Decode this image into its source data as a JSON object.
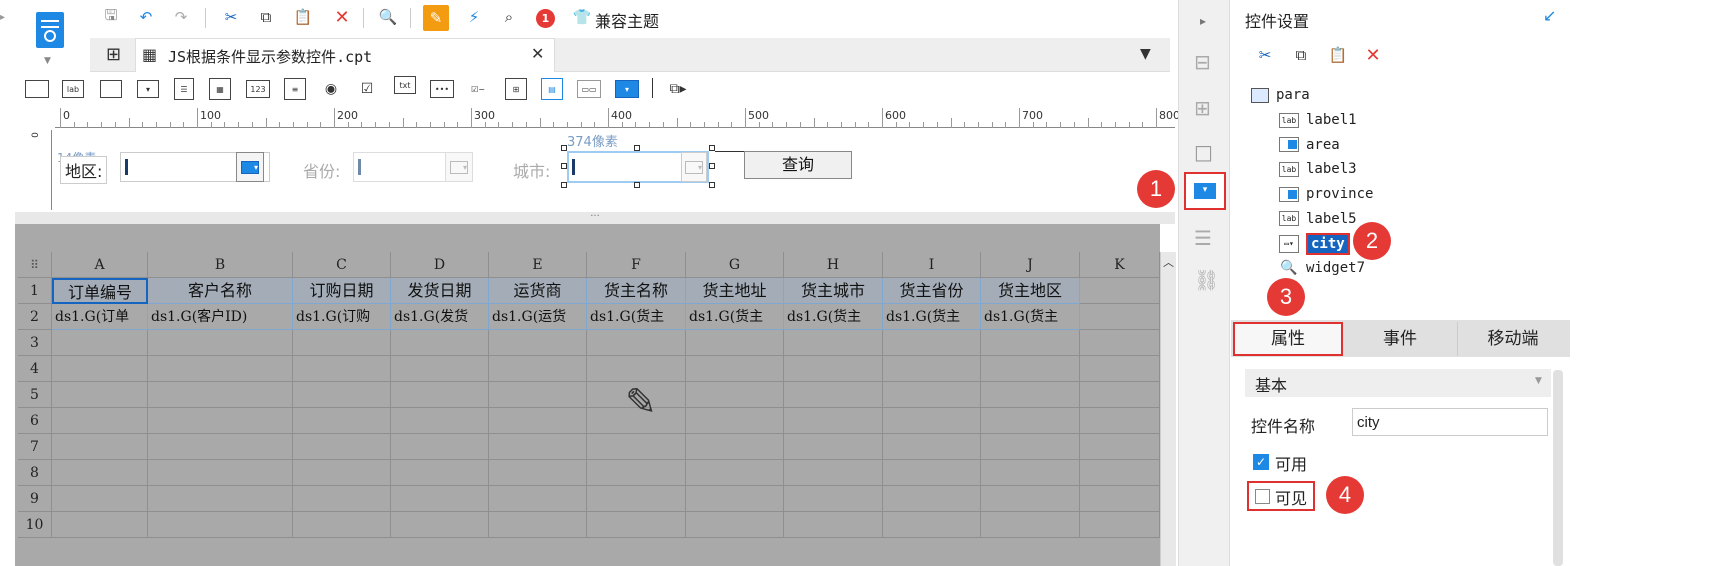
{
  "toolbar": {
    "notify_count": "1",
    "theme_label": "兼容主题"
  },
  "tab": {
    "file_name": "JS根据条件显示参数控件.cpt"
  },
  "widget_palette": [
    "lab",
    "123",
    "txt"
  ],
  "ruler": {
    "ticks": [
      "0",
      "100",
      "200",
      "300",
      "400",
      "500",
      "600",
      "700",
      "800"
    ]
  },
  "param_panel": {
    "size_hint_left": "14像素",
    "size_hint_top": "374像素",
    "area_label": "地区:",
    "province_label": "省份:",
    "city_label": "城市:",
    "query_button": "查询",
    "splitter": "···"
  },
  "sheet": {
    "columns": [
      "A",
      "B",
      "C",
      "D",
      "E",
      "F",
      "G",
      "H",
      "I",
      "J",
      "K"
    ],
    "rows": [
      "1",
      "2",
      "3",
      "4",
      "5",
      "6",
      "7",
      "8",
      "9",
      "10"
    ],
    "header_row": [
      "订单编号",
      "客户名称",
      "订购日期",
      "发货日期",
      "运货商",
      "货主名称",
      "货主地址",
      "货主城市",
      "货主省份",
      "货主地区"
    ],
    "data_row": [
      "ds1.G(订单",
      "ds1.G(客户ID)",
      "ds1.G(订购",
      "ds1.G(发货",
      "ds1.G(运货",
      "ds1.G(货主",
      "ds1.G(货主",
      "ds1.G(货主",
      "ds1.G(货主",
      "ds1.G(货主"
    ]
  },
  "right_panel": {
    "title": "控件设置",
    "tree": {
      "root": "para",
      "items": [
        {
          "label": "label1",
          "icon": "lab"
        },
        {
          "label": "area",
          "icon": "combo"
        },
        {
          "label": "label3",
          "icon": "lab"
        },
        {
          "label": "province",
          "icon": "combo"
        },
        {
          "label": "label5",
          "icon": "lab"
        },
        {
          "label": "city",
          "icon": "tree-combo",
          "selected": true
        },
        {
          "label": "widget7",
          "icon": "query"
        }
      ]
    },
    "tabs": [
      "属性",
      "事件",
      "移动端"
    ],
    "section": "基本",
    "name_label": "控件名称",
    "name_value": "city",
    "enabled_label": "可用",
    "enabled": true,
    "visible_label": "可见",
    "visible": false
  },
  "annotations": [
    "1",
    "2",
    "3",
    "4"
  ],
  "colors": {
    "accent": "#1e88e5",
    "annotation": "#e53935",
    "selection": "#1565c0"
  }
}
